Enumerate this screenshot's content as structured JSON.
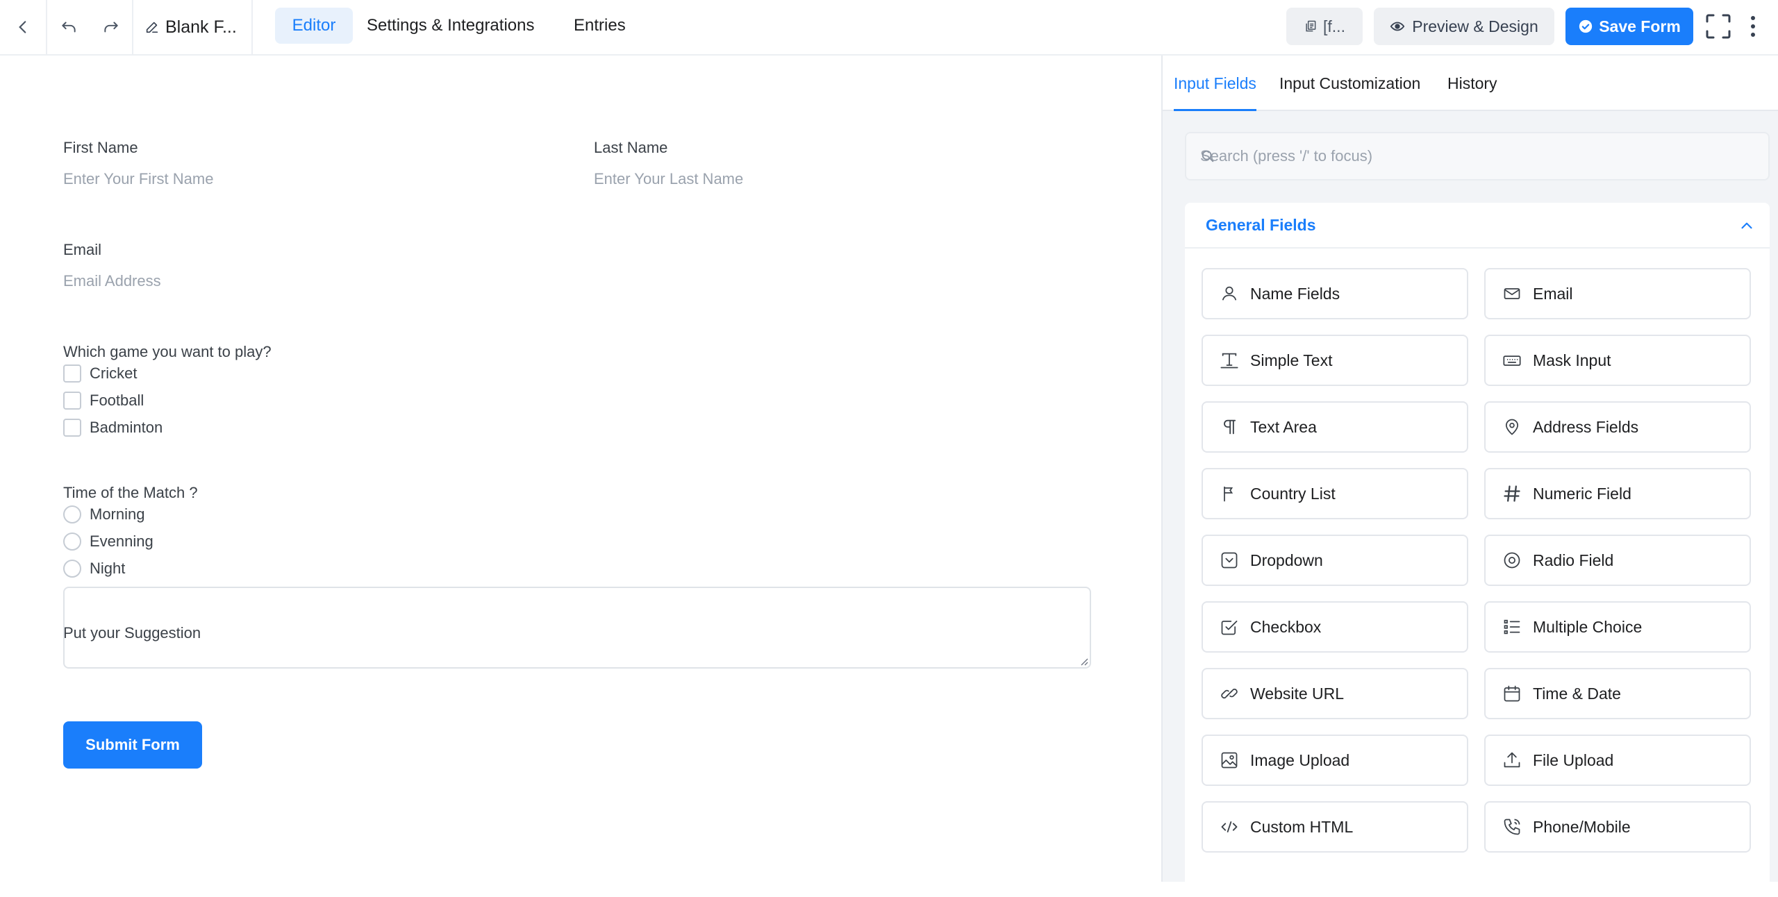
{
  "topbar": {
    "form_title": "Blank F...",
    "tabs": {
      "editor": "Editor",
      "settings": "Settings & Integrations",
      "entries": "Entries"
    },
    "shortcode_label": "[f...",
    "preview_label": "Preview & Design",
    "save_label": "Save Form"
  },
  "form": {
    "first_name": {
      "label": "First Name",
      "placeholder": "Enter Your First Name"
    },
    "last_name": {
      "label": "Last Name",
      "placeholder": "Enter Your Last Name"
    },
    "email": {
      "label": "Email",
      "placeholder": "Email Address"
    },
    "game": {
      "label": "Which game you want to play?",
      "options": [
        "Cricket",
        "Football",
        "Badminton"
      ]
    },
    "time": {
      "label": "Time of the Match ?",
      "options": [
        "Morning",
        "Evenning",
        "Night"
      ]
    },
    "suggestion": {
      "label": "Put your Suggestion"
    },
    "submit_label": "Submit Form"
  },
  "sidebar": {
    "tabs": {
      "input_fields": "Input Fields",
      "input_customization": "Input Customization",
      "history": "History"
    },
    "search_placeholder": "Search (press '/' to focus)",
    "general_fields": {
      "title": "General Fields",
      "items": [
        {
          "label": "Name Fields",
          "icon": "user-icon"
        },
        {
          "label": "Email",
          "icon": "envelope-icon"
        },
        {
          "label": "Simple Text",
          "icon": "text-cursor-icon"
        },
        {
          "label": "Mask Input",
          "icon": "keyboard-icon"
        },
        {
          "label": "Text Area",
          "icon": "paragraph-icon"
        },
        {
          "label": "Address Fields",
          "icon": "map-pin-icon"
        },
        {
          "label": "Country List",
          "icon": "flag-icon"
        },
        {
          "label": "Numeric Field",
          "icon": "hash-icon"
        },
        {
          "label": "Dropdown",
          "icon": "dropdown-icon"
        },
        {
          "label": "Radio Field",
          "icon": "radio-icon"
        },
        {
          "label": "Checkbox",
          "icon": "checkbox-icon"
        },
        {
          "label": "Multiple Choice",
          "icon": "list-icon"
        },
        {
          "label": "Website URL",
          "icon": "link-icon"
        },
        {
          "label": "Time & Date",
          "icon": "calendar-icon"
        },
        {
          "label": "Image Upload",
          "icon": "image-icon"
        },
        {
          "label": "File Upload",
          "icon": "upload-icon"
        },
        {
          "label": "Custom HTML",
          "icon": "code-icon"
        },
        {
          "label": "Phone/Mobile",
          "icon": "phone-icon"
        }
      ]
    }
  },
  "colors": {
    "accent": "#1a7efb",
    "accent_light": "#e8f1fc"
  }
}
